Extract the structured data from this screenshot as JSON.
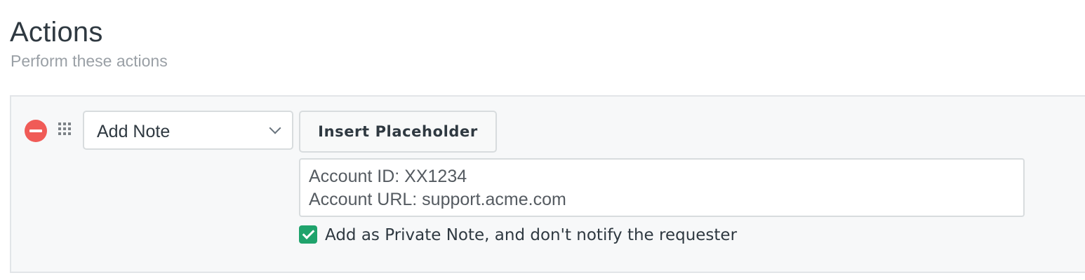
{
  "section": {
    "title": "Actions",
    "subtitle": "Perform these actions"
  },
  "action_row": {
    "remove_icon": "minus-circle-icon",
    "drag_icon": "grip-dots-icon",
    "action_select": {
      "value": "Add Note",
      "icon": "chevron-down-icon"
    },
    "insert_placeholder_label": "Insert Placeholder",
    "note_lines": [
      "Account ID: XX1234",
      "Account URL: support.acme.com"
    ],
    "private_note": {
      "checked": true,
      "label": "Add as Private Note, and don't notify the requester"
    }
  },
  "colors": {
    "remove": "#f05b57",
    "checkbox": "#1fa36c",
    "text": "#2f3941",
    "muted": "#9aa0a6",
    "panel_bg": "#f7f8f9"
  }
}
